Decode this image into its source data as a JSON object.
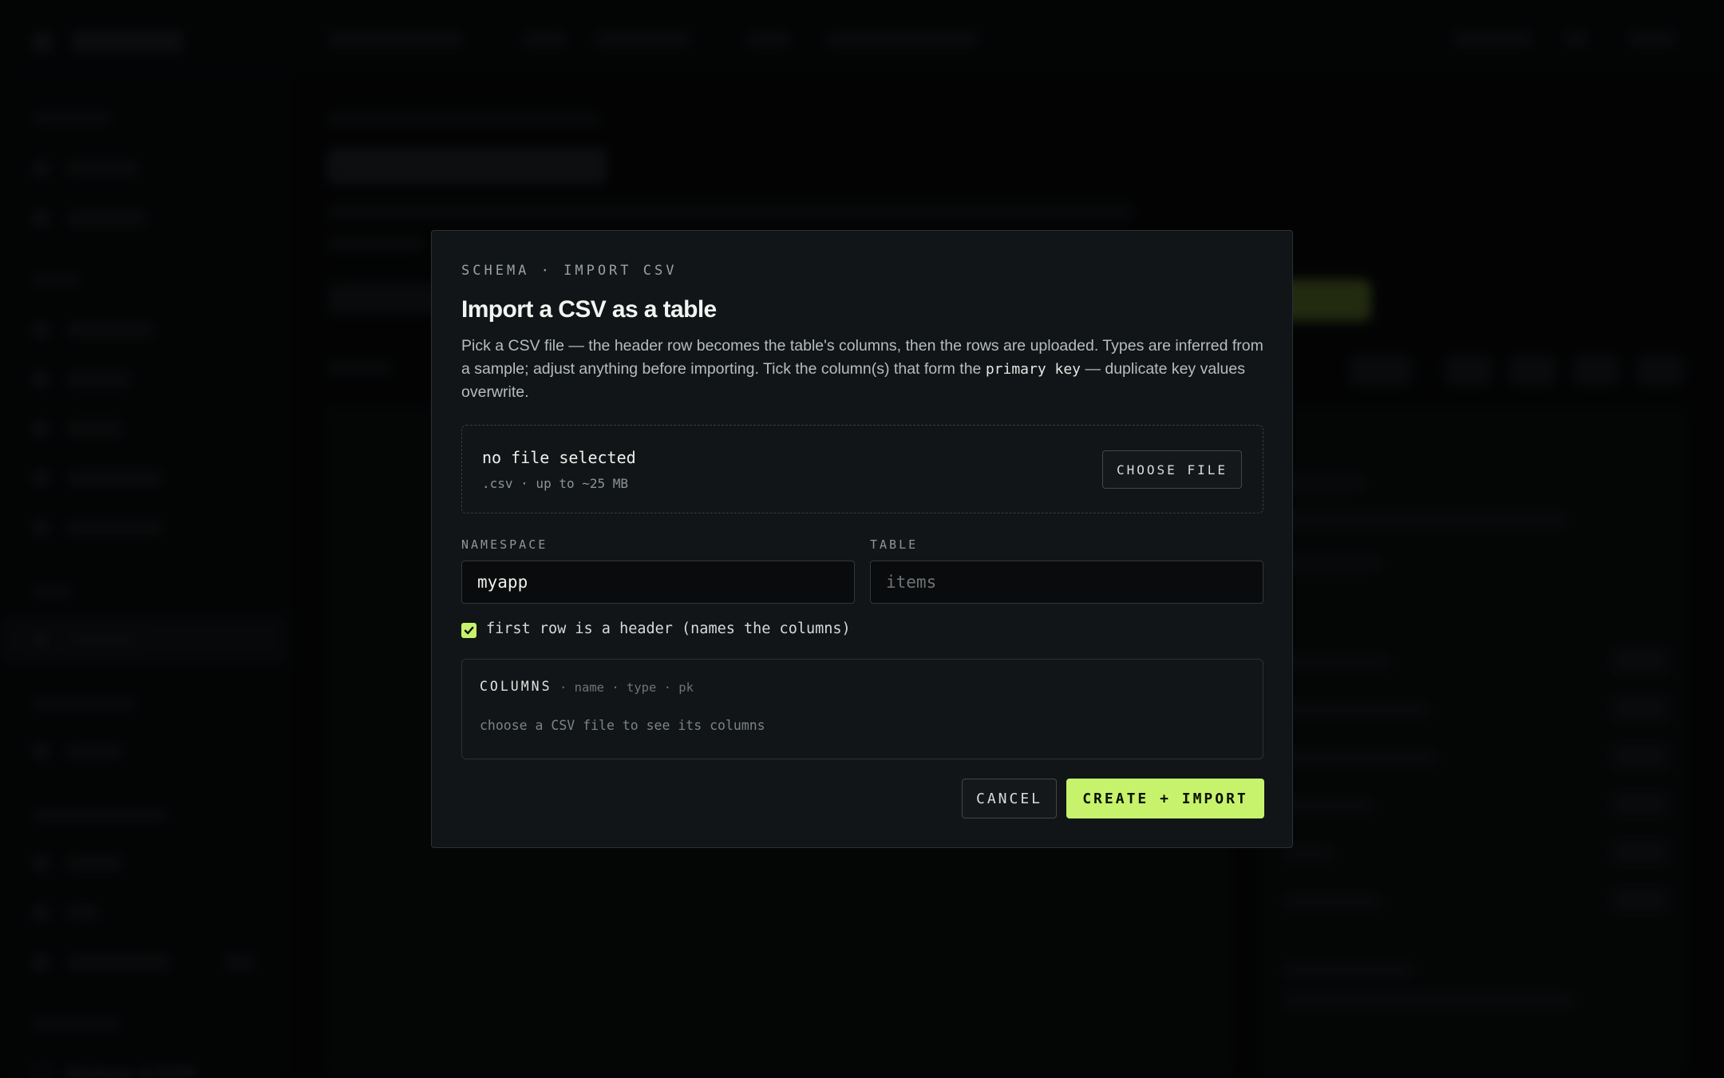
{
  "background": {
    "sidebar_bottom_item": "Backups & PITR"
  },
  "modal": {
    "eyebrow": "SCHEMA · IMPORT CSV",
    "title": "Import a CSV as a table",
    "description_before_code": "Pick a CSV file — the header row becomes the table's columns, then the rows are uploaded. Types are inferred from a sample; adjust anything before importing. Tick the column(s) that form the ",
    "description_code": "primary key",
    "description_after_code": " — duplicate key values overwrite.",
    "dropzone": {
      "title": "no file selected",
      "subtitle": ".csv · up to ~25 MB",
      "choose_label": "CHOOSE FILE"
    },
    "namespace": {
      "label": "NAMESPACE",
      "value": "myapp"
    },
    "table": {
      "label": "TABLE",
      "placeholder": "items"
    },
    "header_checkbox": {
      "checked": true,
      "label": "first row is a header (names the columns)"
    },
    "columns": {
      "heading": "COLUMNS",
      "hint": "· name · type · pk",
      "empty_text": "choose a CSV file to see its columns"
    },
    "cancel_label": "CANCEL",
    "submit_label": "CREATE + IMPORT"
  },
  "colors": {
    "accent": "#c6f36b",
    "modal_bg": "#111517",
    "page_bg": "#050607"
  }
}
